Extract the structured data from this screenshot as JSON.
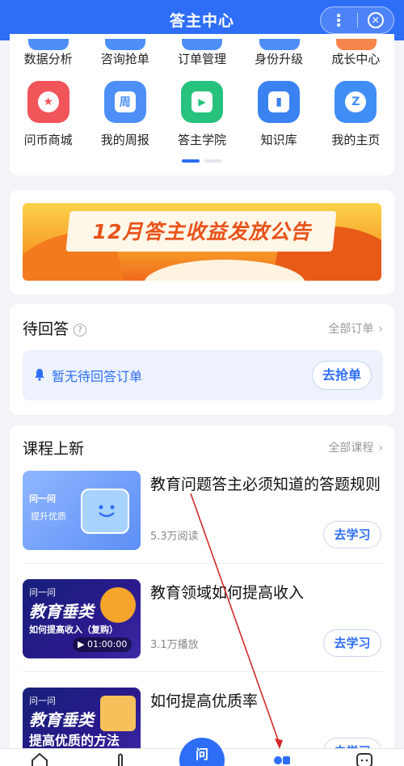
{
  "header": {
    "title": "答主中心",
    "more_icon": "more-icon",
    "close_icon": "close-icon"
  },
  "grid": {
    "row1": [
      "数据分析",
      "咨询抢单",
      "订单管理",
      "身份升级",
      "成长中心"
    ],
    "row2": [
      {
        "label": "问币商城",
        "icon": "coin-shop-icon",
        "color": "#f0555a"
      },
      {
        "label": "我的周报",
        "icon": "weekly-report-icon",
        "color": "#4d8ff7",
        "glyph": "周"
      },
      {
        "label": "答主学院",
        "icon": "academy-icon",
        "color": "#27c27d",
        "glyph": "▶"
      },
      {
        "label": "知识库",
        "icon": "knowledge-base-icon",
        "color": "#3a82f0",
        "glyph": "▮"
      },
      {
        "label": "我的主页",
        "icon": "homepage-icon",
        "color": "#3f8ef5",
        "glyph": "Z"
      }
    ]
  },
  "banner": {
    "text": "12月答主收益发放公告"
  },
  "pending": {
    "title": "待回答",
    "more": "全部订单",
    "empty_text": "暂无待回答订单",
    "button": "去抢单"
  },
  "courses": {
    "title": "课程上新",
    "more": "全部课程",
    "items": [
      {
        "title": "教育问题答主必须知道的答题规则",
        "meta": "5.3万阅读",
        "button": "去学习",
        "thumb": {
          "brand": "问一问",
          "sub": "提升优质"
        }
      },
      {
        "title": "教育领域如何提高收入",
        "meta": "3.1万播放",
        "button": "去学习",
        "thumb": {
          "brand": "问一问",
          "big": "教育垂类",
          "mid": "如何提高收入（复购）",
          "play": "▶ 01:00:00"
        }
      },
      {
        "title": "如何提高优质率",
        "meta": "",
        "button": "去学习",
        "thumb": {
          "brand": "问一问",
          "big": "教育垂类",
          "mid": "提高优质的方法"
        }
      }
    ]
  },
  "tabbar": {
    "center_label": "问"
  },
  "colors": {
    "brand": "#2e6ef7",
    "background": "#f2f4f8"
  }
}
